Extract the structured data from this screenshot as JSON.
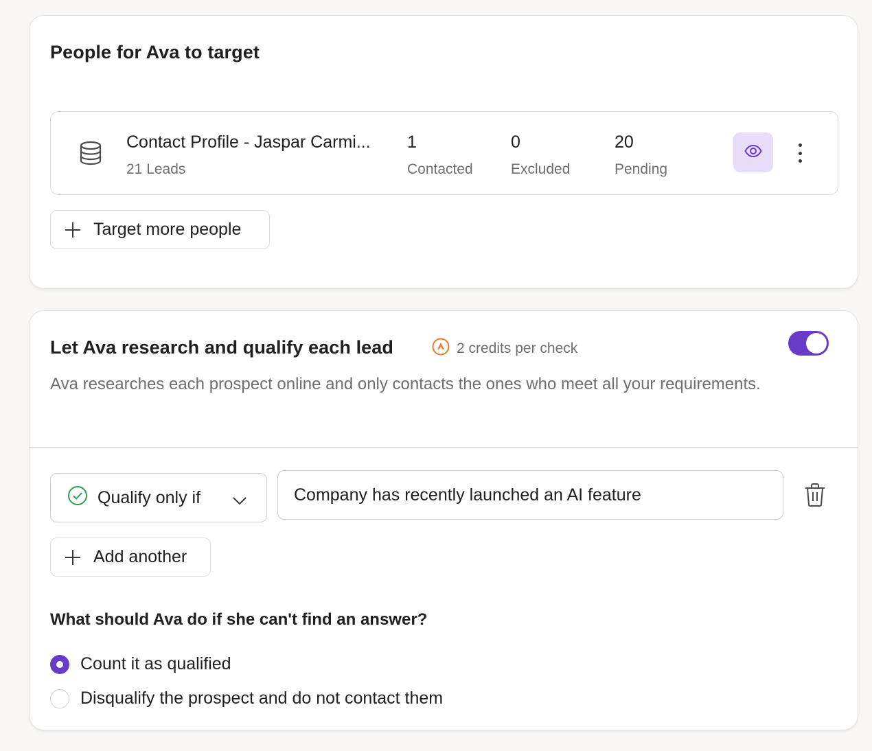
{
  "target_card": {
    "title": "People for Ava to target",
    "list": {
      "name": "Contact Profile - Jaspar Carmi...",
      "leads": "21 Leads",
      "stats": [
        {
          "value": "1",
          "label": "Contacted"
        },
        {
          "value": "0",
          "label": "Excluded"
        },
        {
          "value": "20",
          "label": "Pending"
        }
      ],
      "icon": "database-icon",
      "view_icon": "eye-icon",
      "more_icon": "more-vertical-icon"
    },
    "add_button_label": "Target more people"
  },
  "qualify_card": {
    "title": "Let Ava research and qualify each lead",
    "credits_label": "2 credits per check",
    "credits_icon": "credits-coin-icon",
    "enabled": true,
    "description": "Ava researches each prospect online and only contacts the ones who meet all your requirements.",
    "condition": {
      "selector_label": "Qualify only if",
      "value": "Company has recently launched an AI feature"
    },
    "add_another_label": "Add another",
    "question": "What should Ava do if she can't find an answer?",
    "options": [
      {
        "label": "Count it as qualified",
        "selected": true
      },
      {
        "label": "Disqualify the prospect and do not contact them",
        "selected": false
      }
    ]
  },
  "colors": {
    "accent": "#6a3bc8",
    "accent_soft": "#e7ddf8",
    "credits_orange": "#f07a2a",
    "success_green": "#2e9e4f"
  }
}
